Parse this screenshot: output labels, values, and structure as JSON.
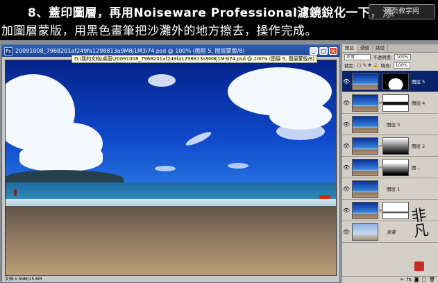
{
  "caption": {
    "line1": "8、蓋印圖層，再用Noiseware Professional濾鏡銳化一下，添",
    "line2": "加圖層蒙版，用黑色畫筆把沙灘外的地方擦去，操作完成。",
    "watermark": "网页教学网"
  },
  "document": {
    "title": "20091008_7968201af249fa1298813a9M8j1M3i74.psd @ 100% (图层 5, 图层蒙版/8)",
    "tooltip": "D:\\我的文档\\桌面\\20091008_7968201af249fa1298813a9M8j1M3i74.psd @ 100% (图层 5, 图层蒙版/8)",
    "status": "文档:1.59M/15.6M",
    "buttons": {
      "minimize": "_",
      "maximize": "□",
      "close": "x"
    }
  },
  "panel": {
    "tabs": [
      "图层",
      "通道",
      "路径"
    ],
    "blend_mode": "正常",
    "opacity_label": "不透明度:",
    "opacity_value": "100%",
    "lock_label": "锁定:",
    "fill_label": "填充:",
    "fill_value": "100%",
    "layers": [
      {
        "name": "图层 5",
        "selected": true,
        "mask": "white-blob"
      },
      {
        "name": "图层 4",
        "selected": false,
        "mask": "white-stripe"
      },
      {
        "name": "图层 3",
        "selected": false,
        "mask": ""
      },
      {
        "name": "图层 2",
        "selected": false,
        "mask": "gradient"
      },
      {
        "name": "图...",
        "selected": false,
        "mask": "gradient"
      },
      {
        "name": "图层 1",
        "selected": false,
        "mask": ""
      },
      {
        "name": "",
        "selected": false,
        "mask": "white"
      },
      {
        "name": "背景",
        "selected": false,
        "mask": ""
      }
    ],
    "signature": "非凡",
    "colors": {
      "selection": "#0a246a",
      "seal": "#c82a24"
    }
  }
}
